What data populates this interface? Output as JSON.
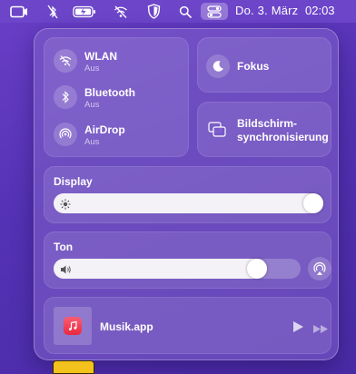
{
  "menubar": {
    "icons": [
      "screen-mirroring-icon",
      "bluetooth-off-icon",
      "battery-icon",
      "wifi-off-icon",
      "shield-icon",
      "spotlight-search-icon",
      "control-center-icon"
    ],
    "date": "Do. 3. März",
    "time": "02:03"
  },
  "control_center": {
    "connectivity": [
      {
        "title": "WLAN",
        "status": "Aus",
        "icon": "wifi-off-icon"
      },
      {
        "title": "Bluetooth",
        "status": "Aus",
        "icon": "bluetooth-icon"
      },
      {
        "title": "AirDrop",
        "status": "Aus",
        "icon": "airdrop-icon"
      }
    ],
    "focus": {
      "label": "Fokus",
      "icon": "moon-icon"
    },
    "screen_mirroring": {
      "line1": "Bildschirm-",
      "line2": "synchronisierung",
      "icon": "screen-mirroring-icon"
    },
    "display": {
      "label": "Display",
      "brightness": 1.0
    },
    "sound": {
      "label": "Ton",
      "volume": 0.85
    },
    "now_playing": {
      "app": "Musik.app"
    }
  },
  "colors": {
    "desktop": "#5432b4",
    "menubar": "#6c45c9",
    "music_badge": "#f2374f"
  }
}
